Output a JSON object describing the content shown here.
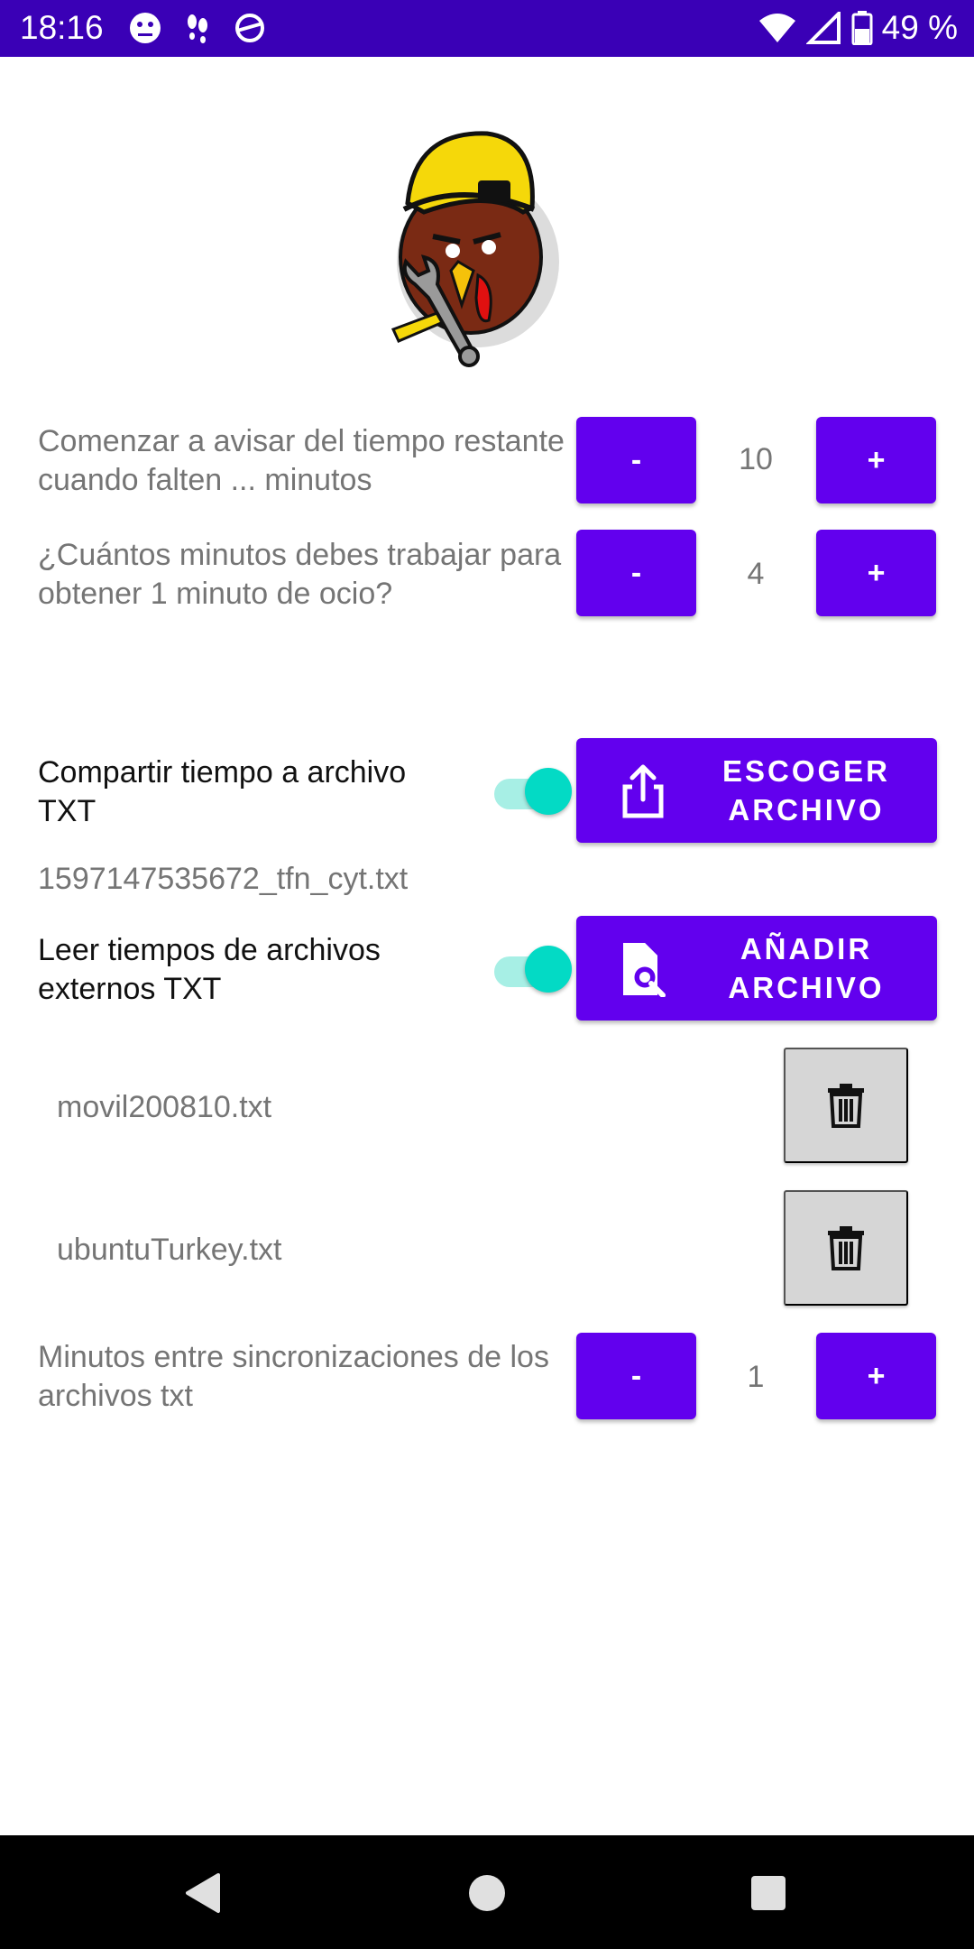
{
  "status_bar": {
    "time": "18:16",
    "battery": "49 %",
    "icons": [
      "emoji-icon",
      "footprints-icon",
      "sync-icon",
      "wifi-icon",
      "signal-icon",
      "battery-icon"
    ]
  },
  "settings": {
    "warn": {
      "label": "Comenzar a avisar del tiempo restante cuando falten ... minutos",
      "minus": "-",
      "value": "10",
      "plus": "+"
    },
    "ratio": {
      "label": "¿Cuántos minutos debes trabajar para obtener 1 minuto de ocio?",
      "minus": "-",
      "value": "4",
      "plus": "+"
    },
    "share": {
      "label": "Compartir tiempo a archivo TXT",
      "enabled": true,
      "button": "ESCOGER ARCHIVO",
      "file": "1597147535672_tfn_cyt.txt"
    },
    "read": {
      "label": "Leer tiempos de archivos externos TXT",
      "enabled": true,
      "button": "AÑADIR ARCHIVO",
      "files": [
        "movil200810.txt",
        "ubuntuTurkey.txt"
      ]
    },
    "sync": {
      "label": "Minutos entre sincronizaciones de los archivos txt",
      "minus": "-",
      "value": "1",
      "plus": "+"
    }
  },
  "colors": {
    "primary": "#6200ee",
    "status_bar": "#3a00b6",
    "accent": "#03dac5"
  }
}
